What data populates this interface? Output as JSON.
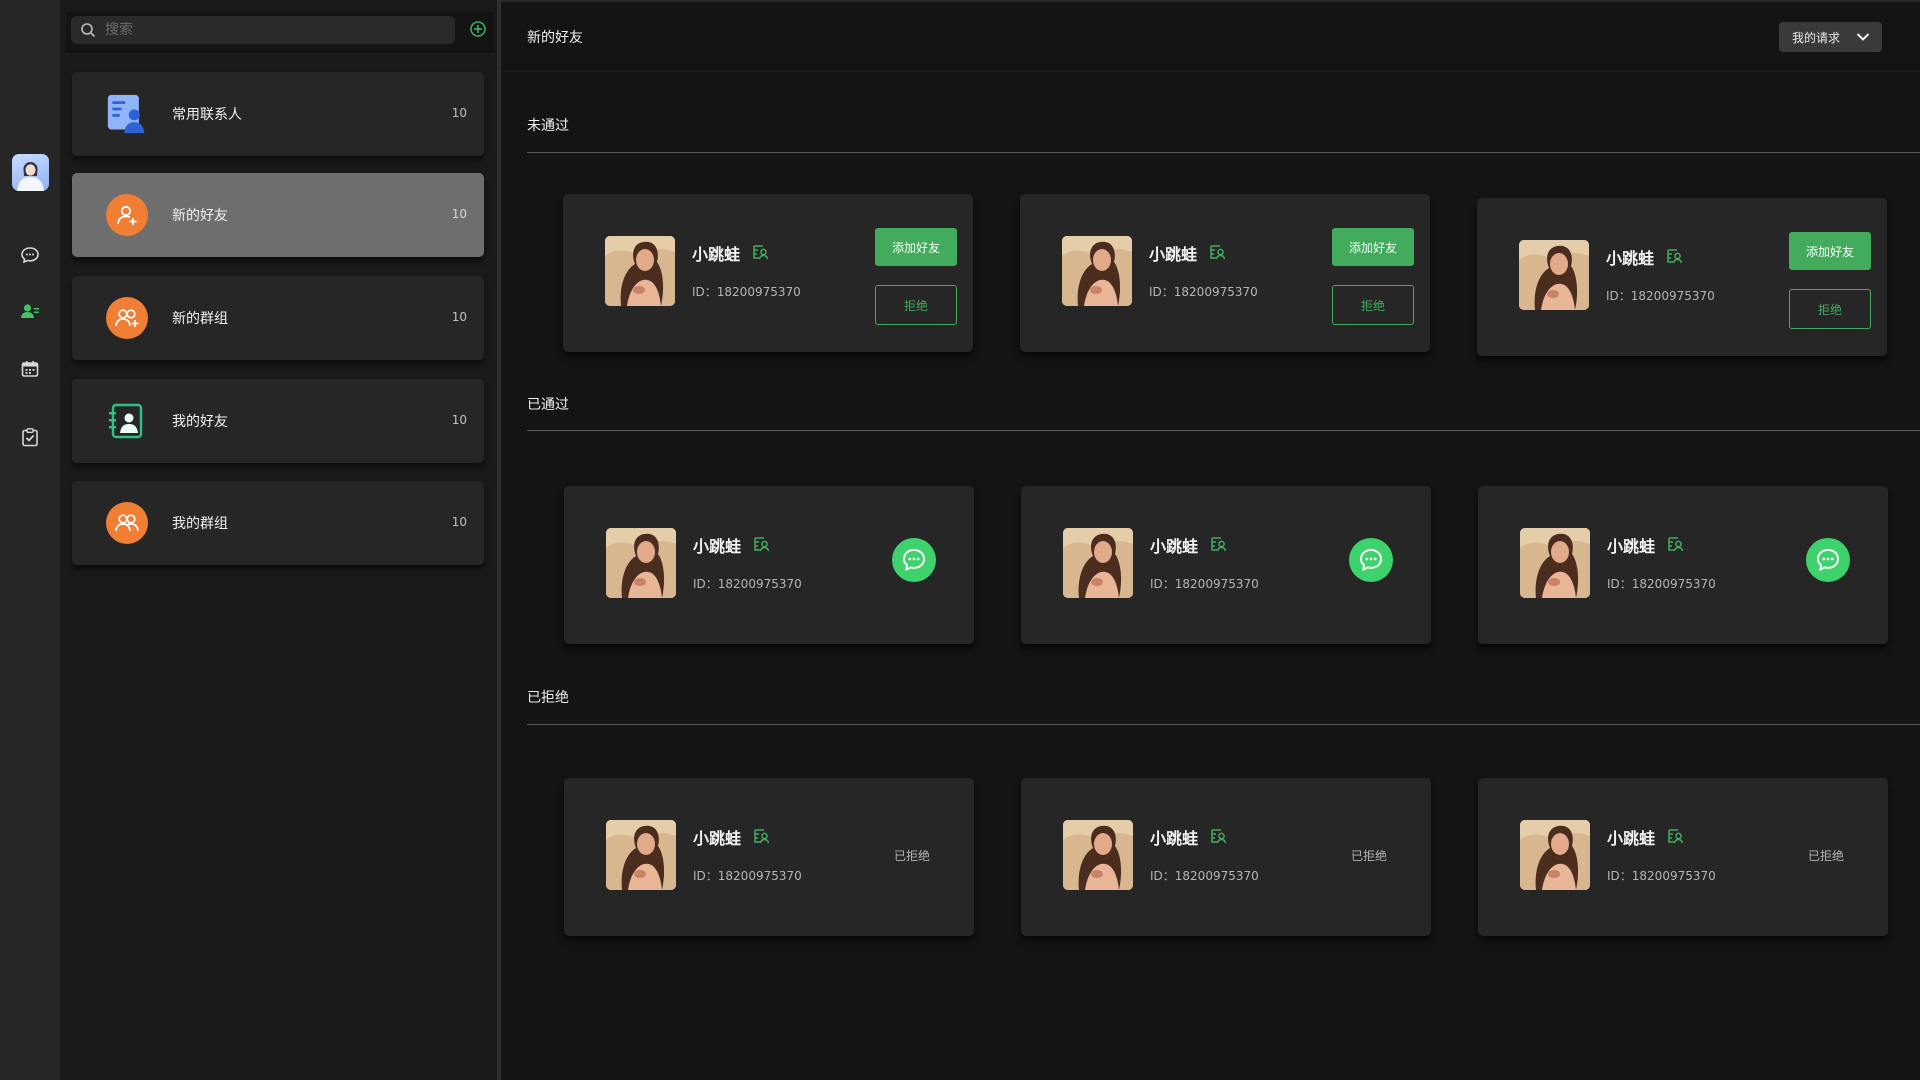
{
  "search": {
    "placeholder": "搜索"
  },
  "contacts": [
    {
      "label": "常用联系人",
      "count": "10",
      "icon": "contacts-card-icon"
    },
    {
      "label": "新的好友",
      "count": "10",
      "icon": "new-friend-icon",
      "active": true
    },
    {
      "label": "新的群组",
      "count": "10",
      "icon": "new-group-icon"
    },
    {
      "label": "我的好友",
      "count": "10",
      "icon": "my-friends-icon"
    },
    {
      "label": "我的群组",
      "count": "10",
      "icon": "my-groups-icon"
    }
  ],
  "main": {
    "title": "新的好友",
    "dropdown_label": "我的请求",
    "sections": {
      "pending": "未通过",
      "approved": "已通过",
      "rejected": "已拒绝"
    }
  },
  "cards": {
    "pending": [
      {
        "name": "小跳蛙",
        "id": "ID：18200975370",
        "add_label": "添加好友",
        "reject_label": "拒绝"
      },
      {
        "name": "小跳蛙",
        "id": "ID：18200975370",
        "add_label": "添加好友",
        "reject_label": "拒绝"
      },
      {
        "name": "小跳蛙",
        "id": "ID：18200975370",
        "add_label": "添加好友",
        "reject_label": "拒绝"
      }
    ],
    "approved": [
      {
        "name": "小跳蛙",
        "id": "ID：18200975370"
      },
      {
        "name": "小跳蛙",
        "id": "ID：18200975370"
      },
      {
        "name": "小跳蛙",
        "id": "ID：18200975370"
      }
    ],
    "rejected": [
      {
        "name": "小跳蛙",
        "id": "ID：18200975370",
        "status": "已拒绝"
      },
      {
        "name": "小跳蛙",
        "id": "ID：18200975370",
        "status": "已拒绝"
      },
      {
        "name": "小跳蛙",
        "id": "ID：18200975370",
        "status": "已拒绝"
      }
    ]
  },
  "colors": {
    "accent": "#43ac5c",
    "chat": "#3dd26c",
    "orange": "#f07e35",
    "active_item": "#6e6e6e"
  }
}
